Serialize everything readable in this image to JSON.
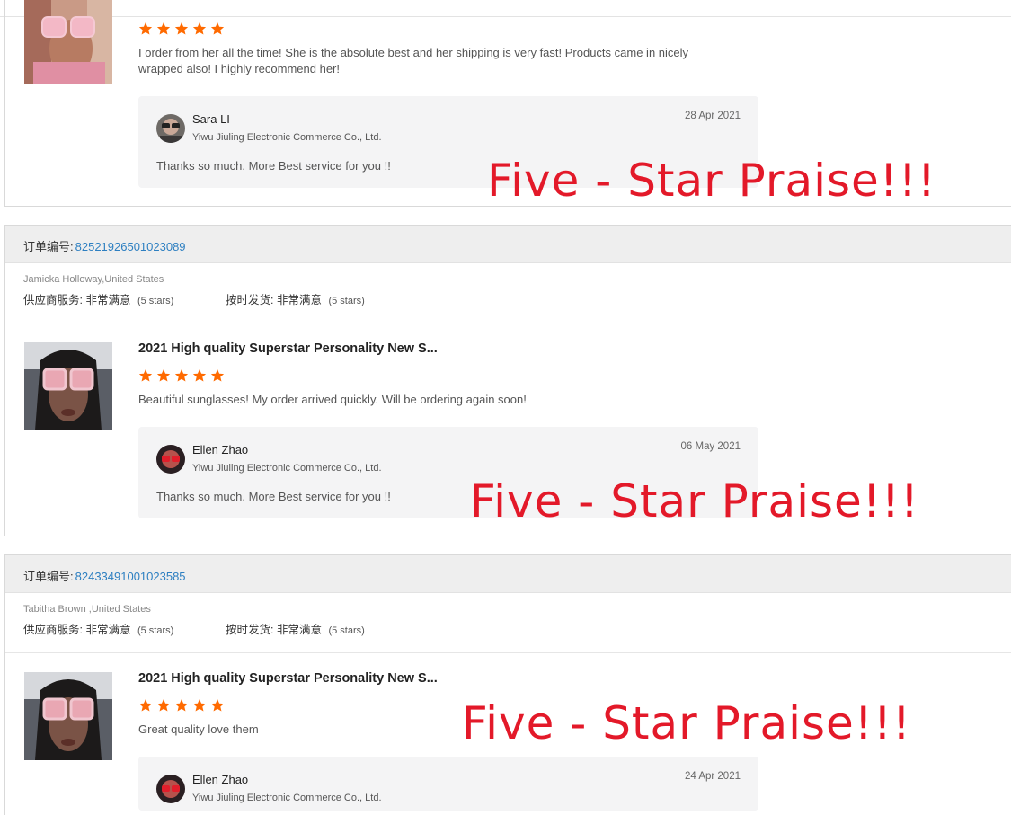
{
  "colors": {
    "accent_red": "#e31929",
    "star_orange": "#ff6a00",
    "link_blue": "#2d7fc1"
  },
  "star_icon": "star-icon",
  "order_label": "订单编号:",
  "rating_labels": {
    "supplier_service": "供应商服务:",
    "on_time_delivery": "按时发货:"
  },
  "reviews": [
    {
      "rating": 5,
      "review_text": "I order from her all the time! She is the absolute best and her shipping is very fast! Products came in nicely wrapped also! I highly recommend her!",
      "reply": {
        "name": "Sara LI",
        "company": "Yiwu Jiuling Electronic Commerce Co., Ltd.",
        "date": "28 Apr 2021",
        "text": "Thanks so much. More Best service for you !!"
      },
      "overlay": "Five - Star Praise!!!"
    },
    {
      "order_number": "82521926501023089",
      "buyer": "Jamicka Holloway,United States",
      "supplier_service_value": "非常满意",
      "supplier_service_stars": "(5 stars)",
      "on_time_value": "非常满意",
      "on_time_stars": "(5 stars)",
      "product_title": "2021 High quality Superstar Personality New S...",
      "rating": 5,
      "review_text": "Beautiful sunglasses! My order arrived quickly. Will be ordering again soon!",
      "reply": {
        "name": "Ellen Zhao",
        "company": "Yiwu Jiuling Electronic Commerce Co., Ltd.",
        "date": "06 May 2021",
        "text": "Thanks so much. More Best service for you !!"
      },
      "overlay": "Five - Star Praise!!!"
    },
    {
      "order_number": "82433491001023585",
      "buyer": "Tabitha Brown ,United States",
      "supplier_service_value": "非常满意",
      "supplier_service_stars": "(5 stars)",
      "on_time_value": "非常满意",
      "on_time_stars": "(5 stars)",
      "product_title": "2021 High quality Superstar Personality New S...",
      "rating": 5,
      "review_text": "Great quality love them",
      "reply": {
        "name": "Ellen Zhao",
        "company": "Yiwu Jiuling Electronic Commerce Co., Ltd.",
        "date": "24 Apr 2021"
      },
      "overlay": "Five - Star Praise!!!"
    }
  ]
}
